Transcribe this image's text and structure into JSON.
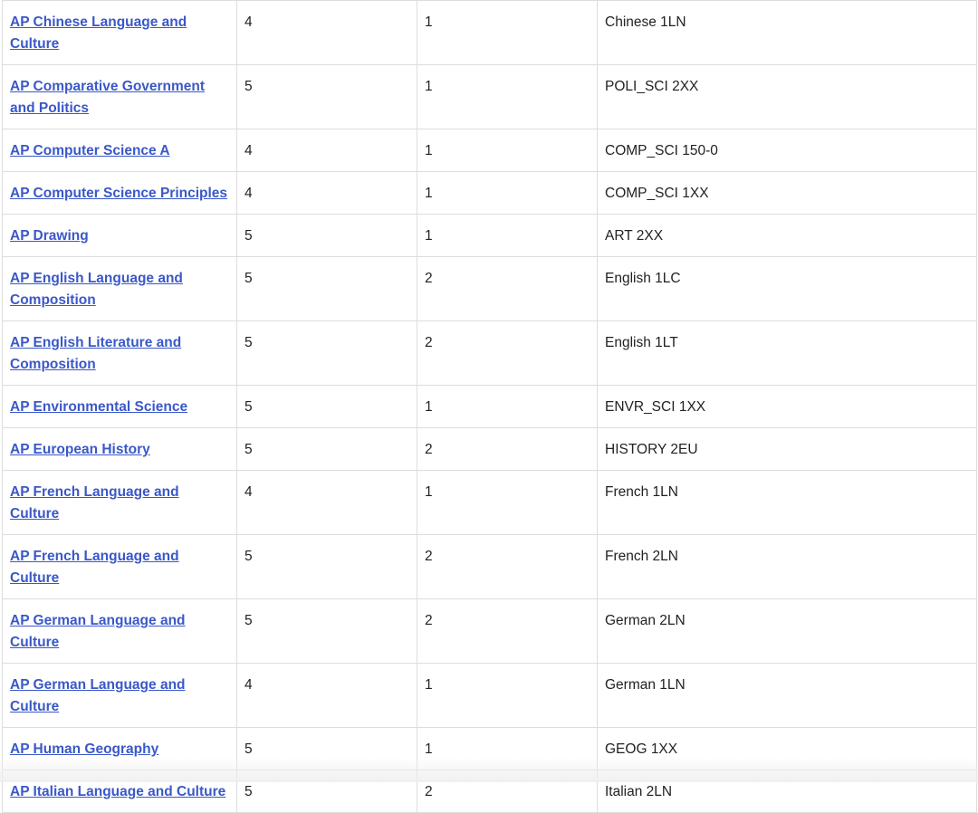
{
  "table": {
    "rows": [
      {
        "exam": "AP Chinese Language and Culture",
        "score": "4",
        "units": "1",
        "equivalent": "Chinese 1LN"
      },
      {
        "exam": "AP Comparative Government and Politics",
        "score": "5",
        "units": "1",
        "equivalent": "POLI_SCI 2XX"
      },
      {
        "exam": "AP Computer Science A",
        "score": "4",
        "units": "1",
        "equivalent": "COMP_SCI 150-0"
      },
      {
        "exam": "AP Computer Science Principles",
        "score": "4",
        "units": "1",
        "equivalent": "COMP_SCI 1XX"
      },
      {
        "exam": "AP Drawing",
        "score": "5",
        "units": "1",
        "equivalent": "ART 2XX"
      },
      {
        "exam": "AP English Language and Composition",
        "score": "5",
        "units": "2",
        "equivalent": "English 1LC"
      },
      {
        "exam": "AP English Literature and Composition",
        "score": "5",
        "units": "2",
        "equivalent": "English 1LT"
      },
      {
        "exam": "AP Environmental Science",
        "score": "5",
        "units": "1",
        "equivalent": "ENVR_SCI 1XX"
      },
      {
        "exam": "AP European History",
        "score": "5",
        "units": "2",
        "equivalent": "HISTORY 2EU"
      },
      {
        "exam": "AP French Language and Culture",
        "score": "4",
        "units": "1",
        "equivalent": "French 1LN"
      },
      {
        "exam": "AP French Language and Culture",
        "score": "5",
        "units": "2",
        "equivalent": "French 2LN"
      },
      {
        "exam": "AP German Language and Culture",
        "score": "5",
        "units": "2",
        "equivalent": "German 2LN"
      },
      {
        "exam": "AP German Language and Culture",
        "score": "4",
        "units": "1",
        "equivalent": "German 1LN"
      },
      {
        "exam": "AP Human Geography",
        "score": "5",
        "units": "1",
        "equivalent": "GEOG 1XX"
      },
      {
        "exam": "AP Italian Language and Culture",
        "score": "5",
        "units": "2",
        "equivalent": "Italian 2LN"
      }
    ]
  }
}
